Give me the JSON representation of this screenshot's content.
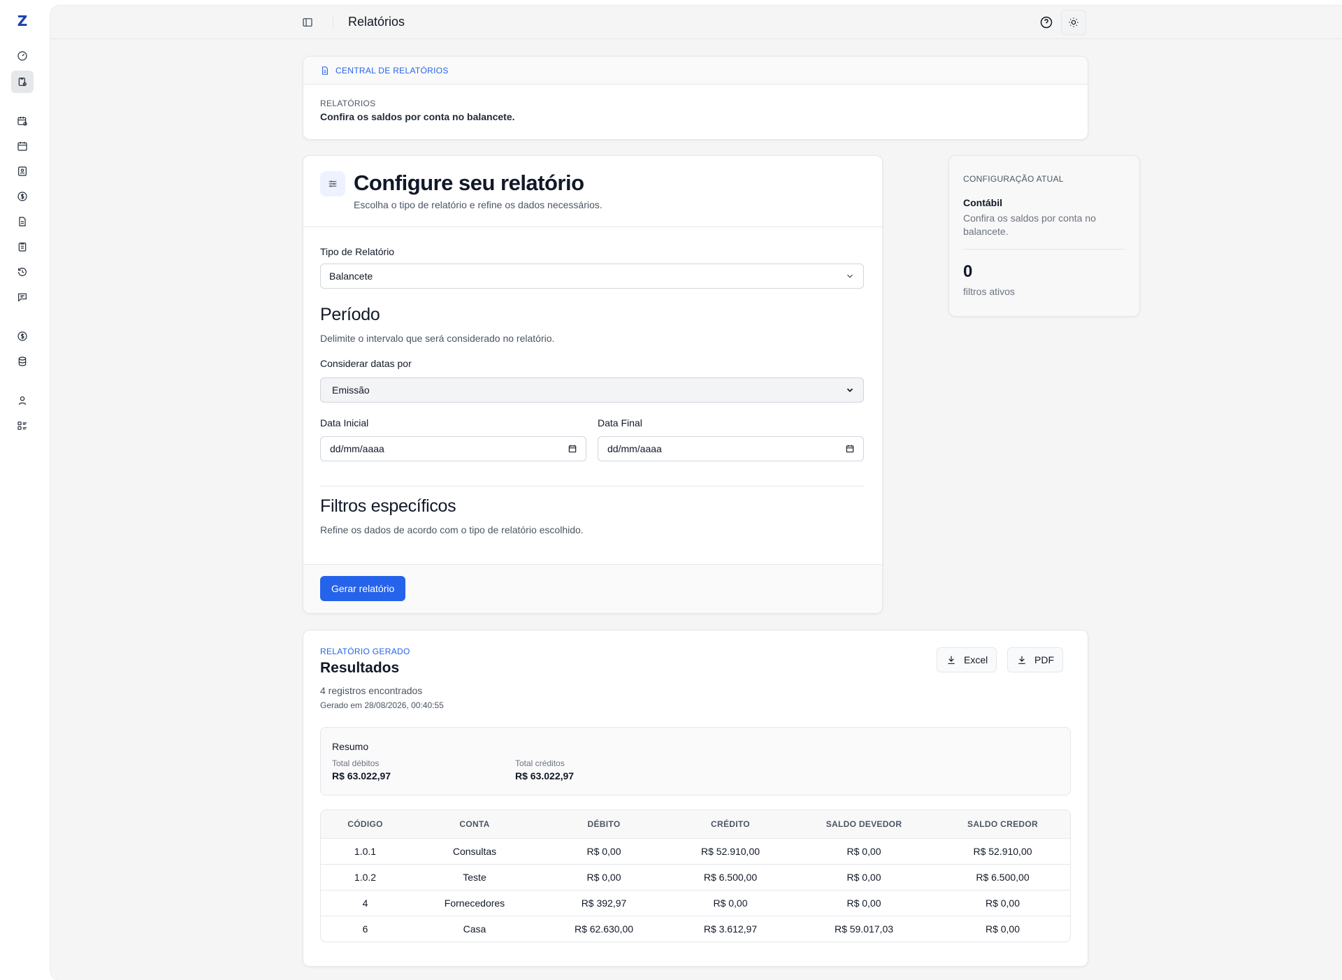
{
  "app": {
    "page_title": "Relatórios",
    "logo_letter": "Z"
  },
  "sidebar": {
    "items": [
      {
        "icon": "dashboard-icon"
      },
      {
        "icon": "reports-icon",
        "active": true
      },
      {
        "icon": "calendar-clock-icon"
      },
      {
        "icon": "calendar-icon"
      },
      {
        "icon": "contact-card-icon"
      },
      {
        "icon": "dollar-circle-icon"
      },
      {
        "icon": "document-icon"
      },
      {
        "icon": "clipboard-icon"
      },
      {
        "icon": "history-icon"
      },
      {
        "icon": "chat-icon"
      },
      {
        "icon": "currency-icon"
      },
      {
        "icon": "database-icon"
      },
      {
        "icon": "user-icon"
      },
      {
        "icon": "list-checks-icon"
      }
    ]
  },
  "central": {
    "header": "CENTRAL DE RELATÓRIOS",
    "eyebrow": "RELATÓRIOS",
    "description": "Confira os saldos por conta no balancete."
  },
  "config": {
    "title": "Configure seu relatório",
    "subtitle": "Escolha o tipo de relatório e refine os dados necessários.",
    "report_type_label": "Tipo de Relatório",
    "report_type_value": "Balancete",
    "period_title": "Período",
    "period_desc": "Delimite o intervalo que será considerado no relatório.",
    "dates_by_label": "Considerar datas por",
    "dates_by_value": "Emissão",
    "start_date_label": "Data Inicial",
    "start_date_placeholder": "dd/mm/aaaa",
    "end_date_label": "Data Final",
    "end_date_placeholder": "dd/mm/aaaa",
    "filters_title": "Filtros específicos",
    "filters_desc": "Refine os dados de acordo com o tipo de relatório escolhido.",
    "generate_label": "Gerar relatório"
  },
  "current": {
    "eyebrow": "CONFIGURAÇÃO ATUAL",
    "type": "Contábil",
    "description": "Confira os saldos por conta no balancete.",
    "active_filters_count": "0",
    "active_filters_label": "filtros ativos"
  },
  "results": {
    "eyebrow": "RELATÓRIO GERADO",
    "title": "Resultados",
    "count": "4 registros encontrados",
    "generated_at": "Gerado em 28/08/2026, 00:40:55",
    "excel_label": "Excel",
    "pdf_label": "PDF",
    "summary": {
      "title": "Resumo",
      "debits_label": "Total débitos",
      "debits_value": "R$ 63.022,97",
      "credits_label": "Total créditos",
      "credits_value": "R$ 63.022,97"
    },
    "table": {
      "columns": [
        "CÓDIGO",
        "CONTA",
        "DÉBITO",
        "CRÉDITO",
        "SALDO DEVEDOR",
        "SALDO CREDOR"
      ],
      "rows": [
        [
          "1.0.1",
          "Consultas",
          "R$ 0,00",
          "R$ 52.910,00",
          "R$ 0,00",
          "R$ 52.910,00"
        ],
        [
          "1.0.2",
          "Teste",
          "R$ 0,00",
          "R$ 6.500,00",
          "R$ 0,00",
          "R$ 6.500,00"
        ],
        [
          "4",
          "Fornecedores",
          "R$ 392,97",
          "R$ 0,00",
          "R$ 0,00",
          "R$ 0,00"
        ],
        [
          "6",
          "Casa",
          "R$ 62.630,00",
          "R$ 3.612,97",
          "R$ 59.017,03",
          "R$ 0,00"
        ]
      ]
    }
  },
  "colors": {
    "accent": "#2563eb",
    "background": "#f5f5f5"
  }
}
